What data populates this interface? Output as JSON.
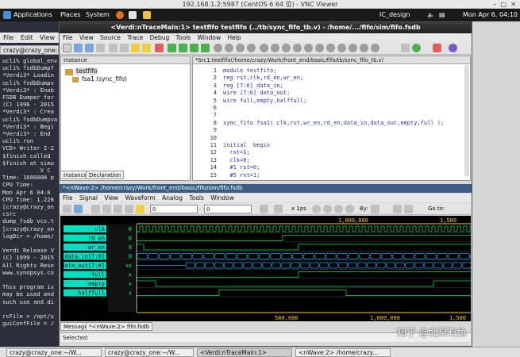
{
  "vnc": {
    "title": "192.168.1.2:5987 (CentOS 6 64 位) - VNC Viewer"
  },
  "panel": {
    "applications": "Applications",
    "places": "Places",
    "system": "System",
    "user": "IC_design",
    "clock": "Mon Apr 6, 04:10"
  },
  "terminal": {
    "menu": [
      "File",
      "Edit",
      "View"
    ],
    "tab": "crazy@crazy_one:~",
    "lines": [
      "ucli% global_env",
      "ucli% fsdbDumpf",
      "*Verdi3* Loadin",
      "ucli% fsdbDumpv",
      "*Verdi3* : Enab",
      "FSDB Dumper for",
      "(C) 1996 - 2015",
      "*Verdi3* : Crea",
      "ucli% fsdbDumpva",
      "*Verdi3* : Begi",
      "*Verdi3* : End",
      "ucli% run",
      "VCD+ Writer I-2",
      "$finish called",
      "$finish at simu",
      "           V C",
      "Time: 1600000 p",
      "CPU Time:",
      "Mon Apr 6 04:0",
      "CPU Time: 1.228",
      "[crazy@crazy_on",
      "csrc",
      "dump_fsdb vcs.t",
      "[crazy@crazy_on",
      "logDir = /home/",
      "",
      "Verdi Release V",
      "(C) 1999 - 2015",
      "All Rights Rese",
      "www.synopsys.co",
      "",
      "This program is",
      "may be used and",
      "such use and di",
      "",
      "rcFile = /opt/s",
      "guiConfFile = /"
    ]
  },
  "verdi": {
    "title": "<Verdi:nTraceMain:1> testfifo testfifo (../tb/sync_fifo_tb.v) - /home/.../fifo/sim/fifo.fsdb",
    "menu": [
      "File",
      "View",
      "Source",
      "Trace",
      "Debug",
      "Tools",
      "Window",
      "Help"
    ],
    "instance_header": "Instance",
    "tree": {
      "top": "testfifo",
      "child": "fsa1 (sync_fifo)"
    },
    "instance_tabs": [
      "Instance",
      "Declaration"
    ],
    "src_header": "*Src1:testfifo(/home/crazy/Work/front_end/basic/fifo/tb/sync_fifo_tb.v)",
    "code": [
      {
        "n": "1",
        "t": "module testfifo;"
      },
      {
        "n": "2",
        "t": "reg rst,clk,rd_en,wr_en;"
      },
      {
        "n": "3",
        "t": "reg [7:0] data_in;"
      },
      {
        "n": "4",
        "t": "wire [7:0] data_out;"
      },
      {
        "n": "5",
        "t": "wire full,empty,halffull;"
      },
      {
        "n": "6",
        "t": ""
      },
      {
        "n": "7",
        "t": ""
      },
      {
        "n": "8",
        "t": "sync_fifo fsa1( clk,rst,wr_en,rd_en,data_in,data_out,empty,full );"
      },
      {
        "n": "9",
        "t": ""
      },
      {
        "n": "10",
        "t": ""
      },
      {
        "n": "11",
        "t": "initial  begin"
      },
      {
        "n": "12",
        "t": "  rst=1;"
      },
      {
        "n": "13",
        "t": "  clk=0;"
      },
      {
        "n": "14",
        "t": "  #1 rst=0;"
      },
      {
        "n": "15",
        "t": "  #5 rst=1;"
      }
    ]
  },
  "wave": {
    "header": "*<nWave:2> /home/crazy/Work/front_end/basic/fifo/sim/fifo.fsdb",
    "menu": [
      "File",
      "Signal",
      "View",
      "Waveform",
      "Analog",
      "Tools",
      "Window"
    ],
    "cursor_val": "0",
    "marker_val": "0",
    "zoom_unit": "x 1ps",
    "by_label": "By:",
    "goto_label": "Go to:",
    "top_ruler": [
      "1,000,000",
      "1,500"
    ],
    "bottom_ruler": [
      "500,000",
      "1,000,000",
      "1,500"
    ],
    "signals": [
      "clk",
      "rd_en",
      "wr_en",
      "data_in[7:0]",
      "data_out[7:0]",
      "full",
      "empty",
      "halffull"
    ],
    "values": [
      "0",
      "0",
      "0",
      "0",
      "xx",
      "x",
      "x",
      "x"
    ],
    "tabs": [
      "Message",
      "*<nWave:2> fifo.fsdb"
    ],
    "status": "Selected:"
  },
  "taskbar": [
    "crazy@crazy_one:~/W...",
    "crazy@crazy_one:~/W...",
    "<Verdi:nTraceMain:1>",
    "<nWave:2> /home/crazy..."
  ],
  "watermark": "知乎 @北冥有鱼",
  "colors": {
    "panel": "#1a1a1a",
    "wave_bg": "#000000",
    "signal_name_bg": "#00e0c0",
    "wave_line": "#00e050",
    "wave_bus": "#00b0ff",
    "code_blue": "#3030b0"
  }
}
